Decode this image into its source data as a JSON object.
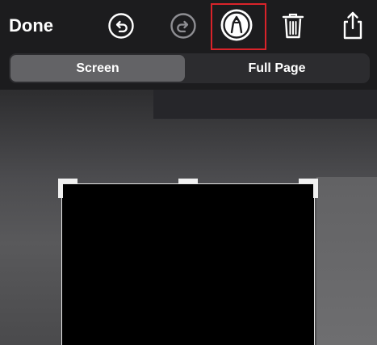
{
  "toolbar": {
    "done_label": "Done",
    "icons": {
      "undo": "undo-icon",
      "redo": "redo-icon",
      "markup": "markup-pen-icon",
      "trash": "trash-icon",
      "share": "share-icon"
    }
  },
  "segmented_control": {
    "options": [
      "Screen",
      "Full Page"
    ],
    "selected": "Screen"
  },
  "colors": {
    "background": "#1c1c1e",
    "highlight": "#d9232a",
    "selected_segment": "#636366",
    "disabled_icon": "#8e8e93"
  }
}
